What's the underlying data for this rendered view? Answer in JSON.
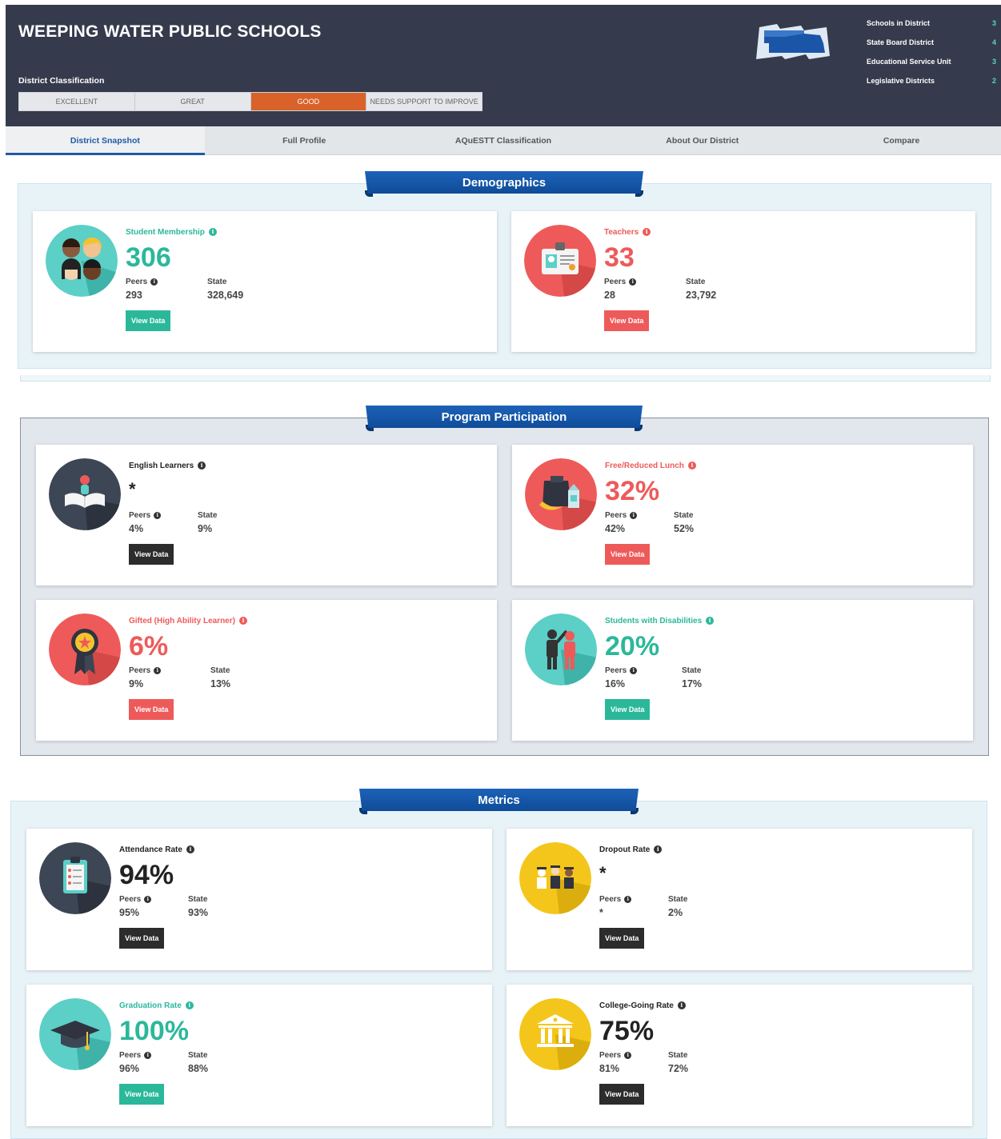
{
  "header": {
    "district_name": "WEEPING WATER PUBLIC SCHOOLS",
    "classification_label": "District Classification",
    "classification_levels": [
      "EXCELLENT",
      "GREAT",
      "GOOD",
      "NEEDS SUPPORT TO IMPROVE"
    ],
    "classification_selected": "GOOD",
    "stats": [
      {
        "label": "Schools in District",
        "value": "3"
      },
      {
        "label": "State Board District",
        "value": "4"
      },
      {
        "label": "Educational Service Unit",
        "value": "3"
      },
      {
        "label": "Legislative Districts",
        "value": "2"
      }
    ]
  },
  "tabs": [
    "District Snapshot",
    "Full Profile",
    "AQuESTT Classification",
    "About Our District",
    "Compare"
  ],
  "active_tab": "District Snapshot",
  "colors": {
    "teal": "#2bb89a",
    "coral": "#ee5a5a",
    "dark": "#2c2c2c",
    "header_bg": "#353b4c",
    "good_orange": "#d9622b",
    "ribbon_blue": "#1d62b8"
  },
  "sections": {
    "demographics": {
      "title": "Demographics",
      "cards": {
        "membership": {
          "label": "Student Membership",
          "value": "306",
          "peers_label": "Peers",
          "peers": "293",
          "state_label": "State",
          "state": "328,649",
          "button": "View Data",
          "icon": "students-faces-icon"
        },
        "teachers": {
          "label": "Teachers",
          "value": "33",
          "peers_label": "Peers",
          "peers": "28",
          "state_label": "State",
          "state": "23,792",
          "button": "View Data",
          "icon": "id-badge-icon"
        }
      }
    },
    "program": {
      "title": "Program Participation",
      "cards": {
        "ell": {
          "label": "English Learners",
          "value": "*",
          "peers_label": "Peers",
          "peers": "4%",
          "state_label": "State",
          "state": "9%",
          "button": "View Data",
          "icon": "reader-book-icon"
        },
        "frl": {
          "label": "Free/Reduced Lunch",
          "value": "32%",
          "peers_label": "Peers",
          "peers": "42%",
          "state_label": "State",
          "state": "52%",
          "button": "View Data",
          "icon": "lunch-bag-icon"
        },
        "gifted": {
          "label": "Gifted (High Ability Learner)",
          "value": "6%",
          "peers_label": "Peers",
          "peers": "9%",
          "state_label": "State",
          "state": "13%",
          "button": "View Data",
          "icon": "award-ribbon-icon"
        },
        "swd": {
          "label": "Students with Disabilities",
          "value": "20%",
          "peers_label": "Peers",
          "peers": "16%",
          "state_label": "State",
          "state": "17%",
          "button": "View Data",
          "icon": "people-icon"
        }
      }
    },
    "metrics": {
      "title": "Metrics",
      "cards": {
        "attendance": {
          "label": "Attendance Rate",
          "value": "94%",
          "peers_label": "Peers",
          "peers": "95%",
          "state_label": "State",
          "state": "93%",
          "button": "View Data",
          "icon": "clipboard-checklist-icon"
        },
        "dropout": {
          "label": "Dropout Rate",
          "value": "*",
          "peers_label": "Peers",
          "peers": "*",
          "state_label": "State",
          "state": "2%",
          "button": "View Data",
          "icon": "graduates-group-icon"
        },
        "graduation": {
          "label": "Graduation Rate",
          "value": "100%",
          "peers_label": "Peers",
          "peers": "96%",
          "state_label": "State",
          "state": "88%",
          "button": "View Data",
          "icon": "graduation-cap-icon"
        },
        "college": {
          "label": "College-Going Rate",
          "value": "75%",
          "peers_label": "Peers",
          "peers": "81%",
          "state_label": "State",
          "state": "72%",
          "button": "View Data",
          "icon": "college-building-icon"
        }
      }
    }
  }
}
